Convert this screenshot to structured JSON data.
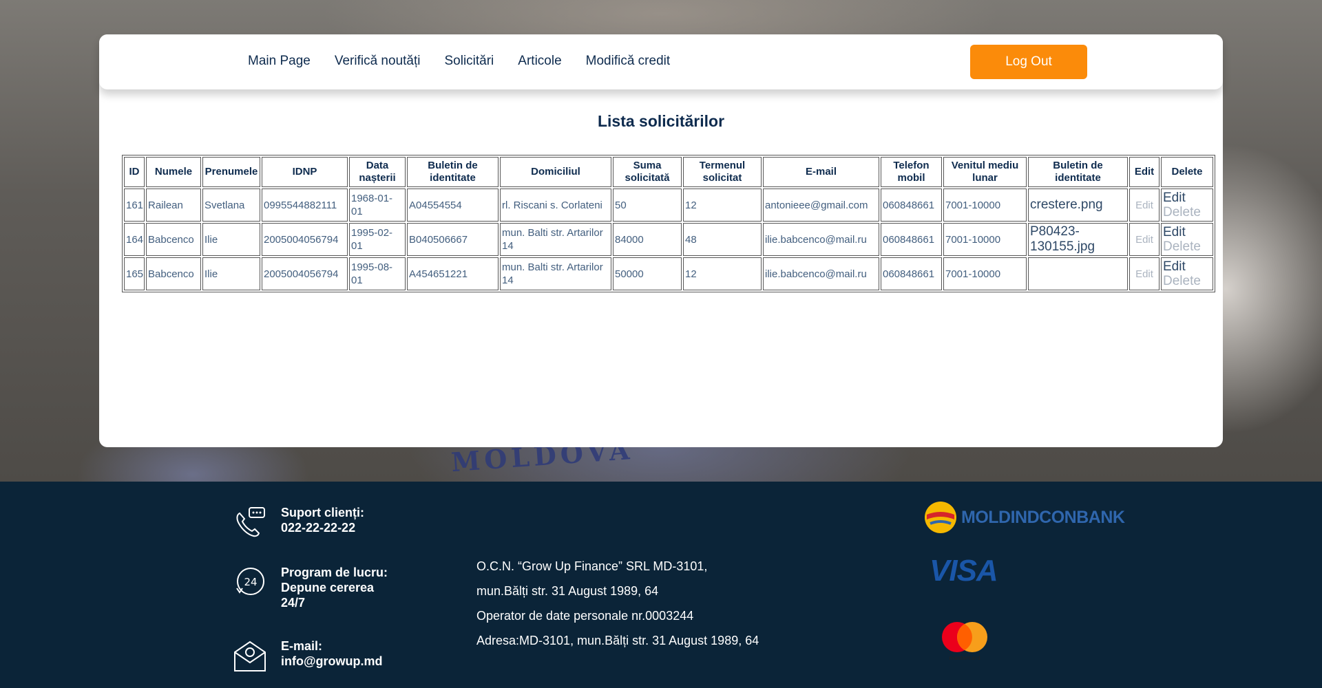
{
  "nav": {
    "items": [
      "Main Page",
      "Verifică noutăți",
      "Solicitări",
      "Articole",
      "Modifică credit"
    ],
    "logout_label": "Log Out"
  },
  "page": {
    "title": "Lista solicitărilor"
  },
  "table": {
    "headers": [
      "ID",
      "Numele",
      "Prenumele",
      "IDNP",
      "Data nașterii",
      "Buletin de identitate",
      "Domiciliul",
      "Suma solicitată",
      "Termenul solicitat",
      "E-mail",
      "Telefon mobil",
      "Venitul mediu lunar",
      "Buletin de identitate",
      "Edit",
      "Delete"
    ],
    "rows": [
      {
        "id": "161",
        "nume": "Railean",
        "prenume": "Svetlana",
        "idnp": "0995544882111",
        "data": "1968-01-01",
        "buletin": "A04554554",
        "domiciliu": "rl. Riscani s. Corlateni",
        "suma": "50",
        "termen": "12",
        "email": "antonieee@gmail.com",
        "telefon": "060848661",
        "venit": "7001-10000",
        "fisier": "crestere.png",
        "edit": "Edit",
        "edit2": "Edit",
        "delete": "Delete"
      },
      {
        "id": "164",
        "nume": "Babcenco",
        "prenume": "Ilie",
        "idnp": "2005004056794",
        "data": "1995-02-01",
        "buletin": "B040506667",
        "domiciliu": "mun. Balti str. Artarilor 14",
        "suma": "84000",
        "termen": "48",
        "email": "ilie.babcenco@mail.ru",
        "telefon": "060848661",
        "venit": "7001-10000",
        "fisier": "P80423-130155.jpg",
        "edit": "Edit",
        "edit2": "Edit",
        "delete": "Delete"
      },
      {
        "id": "165",
        "nume": "Babcenco",
        "prenume": "Ilie",
        "idnp": "2005004056794",
        "data": "1995-08-01",
        "buletin": "A454651221",
        "domiciliu": "mun. Balti str. Artarilor 14",
        "suma": "50000",
        "termen": "12",
        "email": "ilie.babcenco@mail.ru",
        "telefon": "060848661",
        "venit": "7001-10000",
        "fisier": "",
        "edit": "Edit",
        "edit2": "Edit",
        "delete": "Delete"
      }
    ]
  },
  "background": {
    "banknote_text": "MOLDOVA"
  },
  "footer": {
    "support_label": "Suport clienți:",
    "support_phone": "022-22-22-22",
    "program_label": "Program de lucru:",
    "program_line1": "Depune cererea",
    "program_line2": "24/7",
    "email_label": "E-mail:",
    "email_value": "info@growup.md",
    "address_lines": [
      "O.C.N. “Grow Up Finance” SRL MD-3101,",
      "mun.Bălți str. 31 August 1989, 64",
      "Operator de date personale nr.0003244",
      "Adresa:MD-3101, mun.Bălți str. 31 August 1989, 64"
    ],
    "partners": {
      "bank": "MOLDINDCONBANK",
      "visa": "VISA",
      "mastercard": "mastercard"
    }
  },
  "colors": {
    "accent": "#fb8b0a",
    "navy": "#0e2b4e",
    "footer_bg": "#0b2438"
  }
}
